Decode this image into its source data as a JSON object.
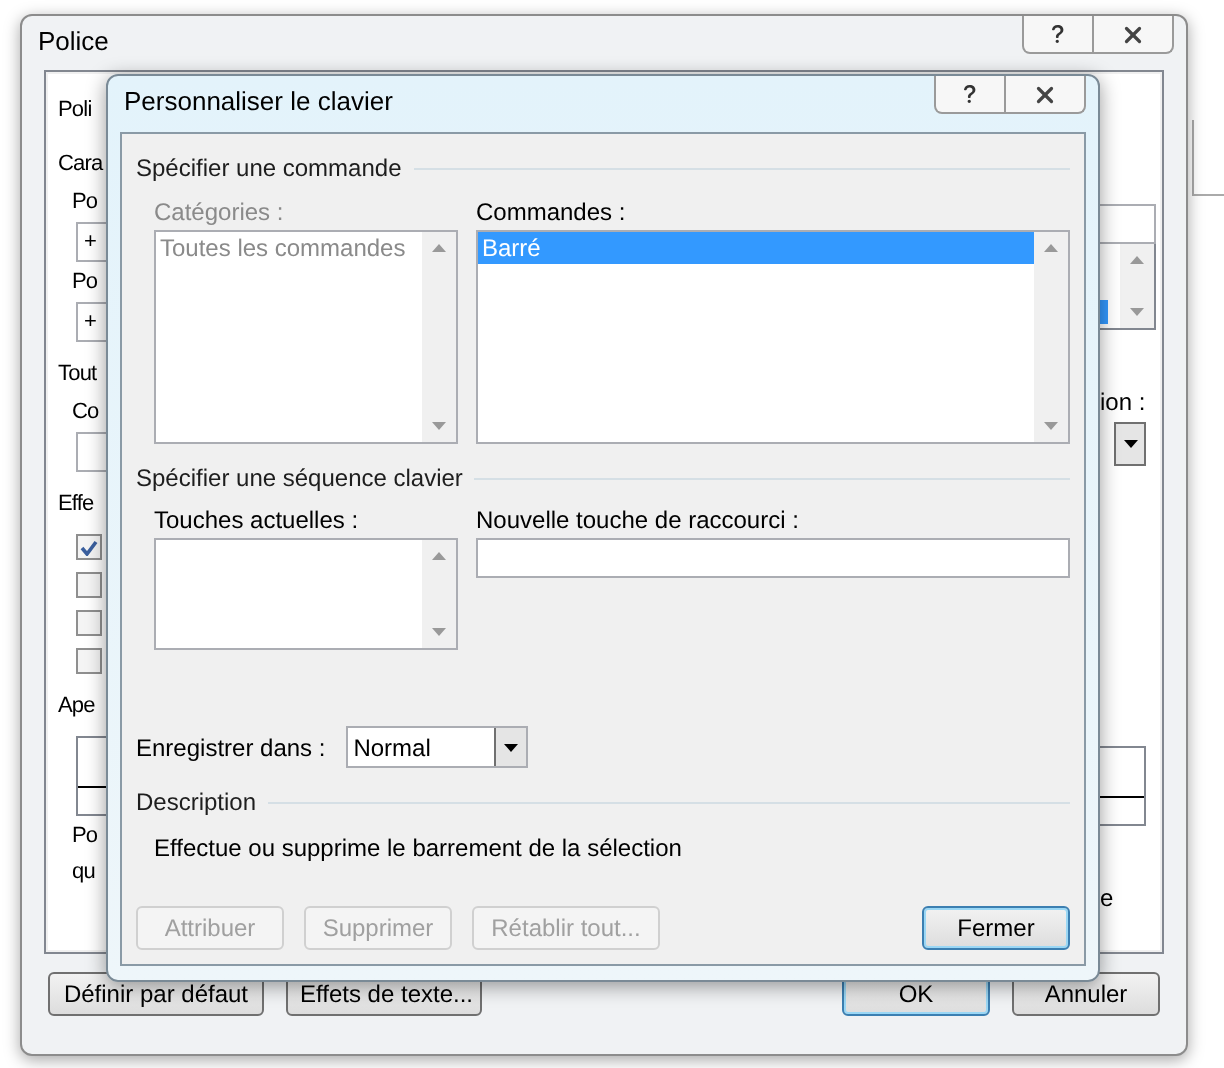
{
  "police_window": {
    "title": "Police",
    "left_fragments": [
      {
        "kind": "tab",
        "text": "Poli"
      },
      {
        "kind": "heading",
        "text": "Cara"
      },
      {
        "kind": "label",
        "text": "Po"
      },
      {
        "kind": "field",
        "text": "+"
      },
      {
        "kind": "label",
        "text": "Po"
      },
      {
        "kind": "field",
        "text": "+"
      },
      {
        "kind": "heading",
        "text": "Tout"
      },
      {
        "kind": "label",
        "text": "Co"
      },
      {
        "kind": "field"
      },
      {
        "kind": "heading",
        "text": "Effe"
      },
      {
        "kind": "checkbox",
        "checked": true
      },
      {
        "kind": "checkbox",
        "checked": false
      },
      {
        "kind": "checkbox",
        "checked": false
      },
      {
        "kind": "checkbox",
        "checked": false
      },
      {
        "kind": "heading",
        "text": "Ape"
      },
      {
        "kind": "preview"
      },
      {
        "kind": "label",
        "text": "Po"
      },
      {
        "kind": "label",
        "text": "qu"
      }
    ],
    "right_fragments": [
      {
        "kind": "field"
      },
      {
        "kind": "list"
      },
      {
        "kind": "label",
        "text": "ion :"
      },
      {
        "kind": "dropdown"
      },
      {
        "kind": "preview"
      },
      {
        "kind": "label",
        "text": "e"
      }
    ],
    "buttons": [
      {
        "label": "Définir par défaut",
        "default": false
      },
      {
        "label": "Effets de texte...",
        "default": false
      },
      {
        "label": "OK",
        "default": true
      },
      {
        "label": "Annuler",
        "default": false
      }
    ]
  },
  "keyboard_dialog": {
    "title": "Personnaliser le clavier",
    "command_section": {
      "title": "Spécifier une commande",
      "categories": {
        "label": "Catégories :",
        "disabled": true,
        "items": [
          {
            "text": "Toutes les commandes",
            "selected": false
          }
        ]
      },
      "commands": {
        "label": "Commandes :",
        "disabled": false,
        "items": [
          {
            "text": "Barré",
            "selected": true
          }
        ]
      }
    },
    "key_section": {
      "title": "Spécifier une séquence clavier",
      "current_keys": {
        "label": "Touches actuelles :"
      },
      "new_key": {
        "label": "Nouvelle touche de raccourci :"
      }
    },
    "save_in": {
      "label": "Enregistrer dans :",
      "value": "Normal"
    },
    "description": {
      "title": "Description",
      "text": "Effectue ou supprime le barrement de la sélection"
    },
    "buttons": [
      {
        "label": "Attribuer",
        "disabled": true,
        "default": false
      },
      {
        "label": "Supprimer",
        "disabled": true,
        "default": false
      },
      {
        "label": "Rétablir tout...",
        "disabled": true,
        "default": false
      },
      {
        "label": "Fermer",
        "disabled": false,
        "default": true
      }
    ]
  }
}
